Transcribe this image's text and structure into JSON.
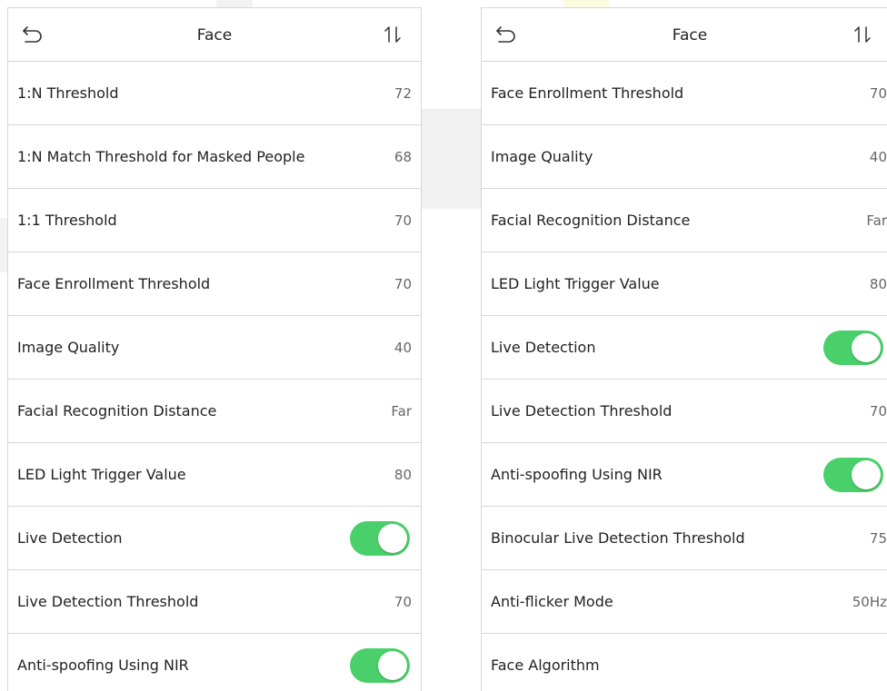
{
  "left_panel": {
    "title": "Face",
    "rows": [
      {
        "label": "1:N Threshold",
        "value": "72"
      },
      {
        "label": "1:N Match Threshold for Masked People",
        "value": "68"
      },
      {
        "label": "1:1 Threshold",
        "value": "70"
      },
      {
        "label": "Face Enrollment Threshold",
        "value": "70"
      },
      {
        "label": "Image Quality",
        "value": "40"
      },
      {
        "label": "Facial Recognition Distance",
        "value": "Far"
      },
      {
        "label": "LED Light Trigger Value",
        "value": "80"
      },
      {
        "label": "Live Detection",
        "toggle": "on"
      },
      {
        "label": "Live Detection Threshold",
        "value": "70"
      },
      {
        "label": "Anti-spoofing Using NIR",
        "toggle": "on"
      }
    ]
  },
  "right_panel": {
    "title": "Face",
    "rows": [
      {
        "label": "Face Enrollment Threshold",
        "value": "70"
      },
      {
        "label": "Image Quality",
        "value": "40"
      },
      {
        "label": "Facial Recognition Distance",
        "value": "Far"
      },
      {
        "label": "LED Light Trigger Value",
        "value": "80"
      },
      {
        "label": "Live Detection",
        "toggle": "on"
      },
      {
        "label": "Live Detection Threshold",
        "value": "70"
      },
      {
        "label": "Anti-spoofing Using NIR",
        "toggle": "on"
      },
      {
        "label": "Binocular Live Detection Threshold",
        "value": "75"
      },
      {
        "label": "Anti-flicker Mode",
        "value": "50Hz"
      },
      {
        "label": "Face Algorithm",
        "value": ""
      }
    ]
  },
  "icons": {
    "back": "back-arrow-icon",
    "sort": "sort-icon"
  },
  "colors": {
    "toggle_on": "#4ad06a",
    "divider": "#d6d6d6",
    "value_text": "#666666"
  }
}
